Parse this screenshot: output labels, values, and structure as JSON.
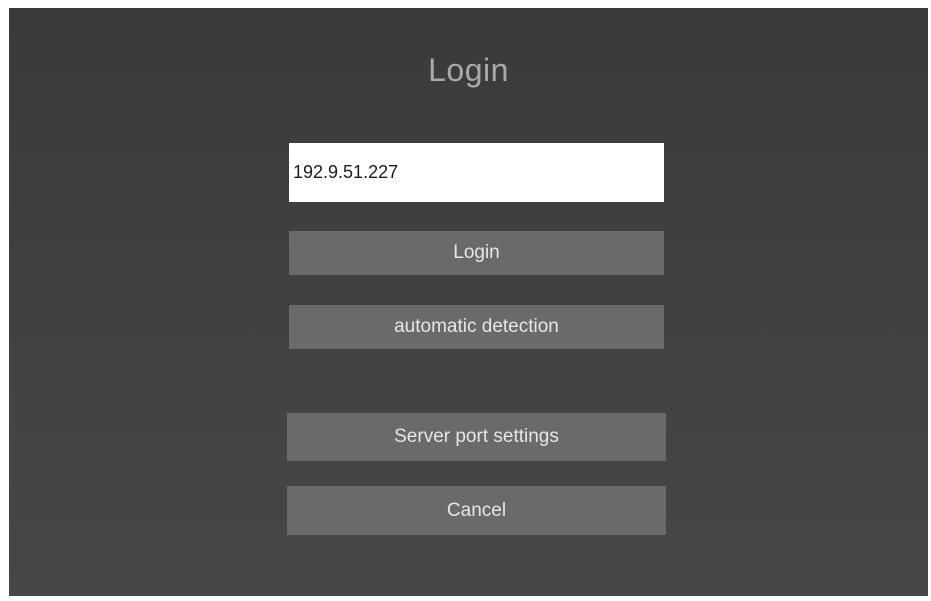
{
  "dialog": {
    "title": "Login",
    "server_ip": {
      "value": "192.9.51.227",
      "placeholder": ""
    },
    "buttons": {
      "login": "Login",
      "automatic_detection": "automatic detection",
      "server_port_settings": "Server port settings",
      "cancel": "Cancel"
    }
  },
  "colors": {
    "background": "#404040",
    "button": "#6a6a6a",
    "button_text": "#e6e6e6",
    "title_text": "#a9a9a9",
    "input_background": "#ffffff"
  }
}
